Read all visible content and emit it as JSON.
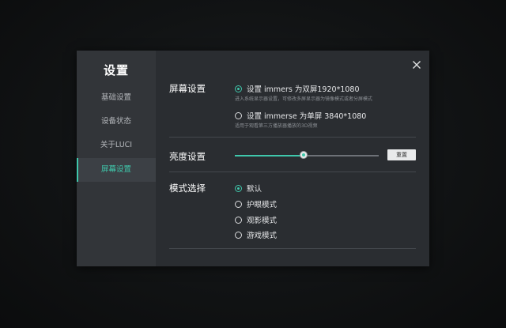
{
  "sidebar": {
    "title": "设置",
    "items": [
      {
        "label": "基础设置"
      },
      {
        "label": "设备状态"
      },
      {
        "label": "关于LUCI"
      },
      {
        "label": "屏幕设置"
      }
    ]
  },
  "screen_section": {
    "label": "屏幕设置",
    "options": [
      {
        "label": "设置 immers 为双屏1920*1080",
        "description": "进入系统显示器设置，可修改多屏显示器为镜像模式或者分屏模式",
        "checked": true
      },
      {
        "label": "设置 immerse 为单屏 3840*1080",
        "description": "适用于观看第三方播放器播放的3D视频",
        "checked": false
      }
    ]
  },
  "brightness_section": {
    "label": "亮度设置",
    "level": 0.48,
    "reset_label": "重置"
  },
  "mode_section": {
    "label": "模式选择",
    "options": [
      {
        "label": "默认",
        "checked": true
      },
      {
        "label": "护眼模式",
        "checked": false
      },
      {
        "label": "观影模式",
        "checked": false
      },
      {
        "label": "游戏模式",
        "checked": false
      }
    ]
  },
  "colors": {
    "accent": "#3fc7ab",
    "dialog_bg": "#2a2d31",
    "sidebar_bg": "#323539"
  },
  "icons": {
    "close": "close-icon"
  }
}
